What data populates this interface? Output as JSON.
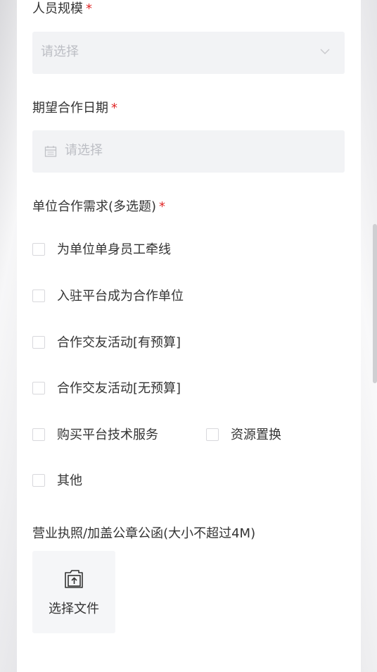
{
  "form": {
    "staff_size": {
      "label": "人员规模",
      "required": "*",
      "placeholder": "请选择"
    },
    "coop_date": {
      "label": "期望合作日期",
      "required": "*",
      "placeholder": "请选择"
    },
    "needs": {
      "label": "单位合作需求(多选题)",
      "required": "*",
      "options": [
        "为单位单身员工牵线",
        "入驻平台成为合作单位",
        "合作交友活动[有预算]",
        "合作交友活动[无预算]",
        "购买平台技术服务",
        "资源置换",
        "其他"
      ]
    },
    "license": {
      "label": "营业执照/加盖公章公函(大小不超过4M)",
      "button": "选择文件"
    }
  },
  "icons": {
    "dropdown": "chevron-down-icon",
    "date": "calendar-icon",
    "upload": "file-upload-icon"
  },
  "colors": {
    "required": "#e02828",
    "input_bg": "#f2f3f5",
    "placeholder": "#bcbec4",
    "text": "#333333"
  }
}
